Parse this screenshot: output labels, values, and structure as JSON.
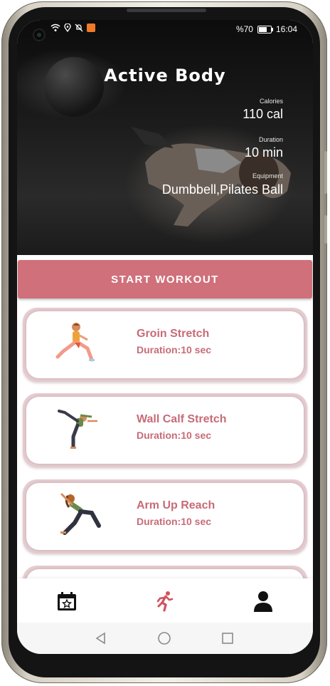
{
  "status_bar": {
    "battery": "%70",
    "time": "16:04"
  },
  "hero": {
    "title": "Active Body",
    "stats": [
      {
        "label": "Calories",
        "value": "110 cal"
      },
      {
        "label": "Duration",
        "value": "10 min"
      },
      {
        "label": "Equipment",
        "value": "Dumbbell,Pilates Ball"
      }
    ]
  },
  "start_button": {
    "label": "START WORKOUT"
  },
  "exercises": [
    {
      "name": "Groin Stretch",
      "duration": "Duration:10 sec"
    },
    {
      "name": "Wall Calf Stretch",
      "duration": "Duration:10 sec"
    },
    {
      "name": "Arm Up Reach",
      "duration": "Duration:10 sec"
    }
  ],
  "bottom_nav": {
    "items": [
      {
        "icon": "calendar-star-icon"
      },
      {
        "icon": "running-person-icon",
        "active": true
      },
      {
        "icon": "user-profile-icon"
      }
    ],
    "active_color": "#d0525e"
  },
  "colors": {
    "accent": "#d0707a",
    "card_text": "#c76b77"
  }
}
